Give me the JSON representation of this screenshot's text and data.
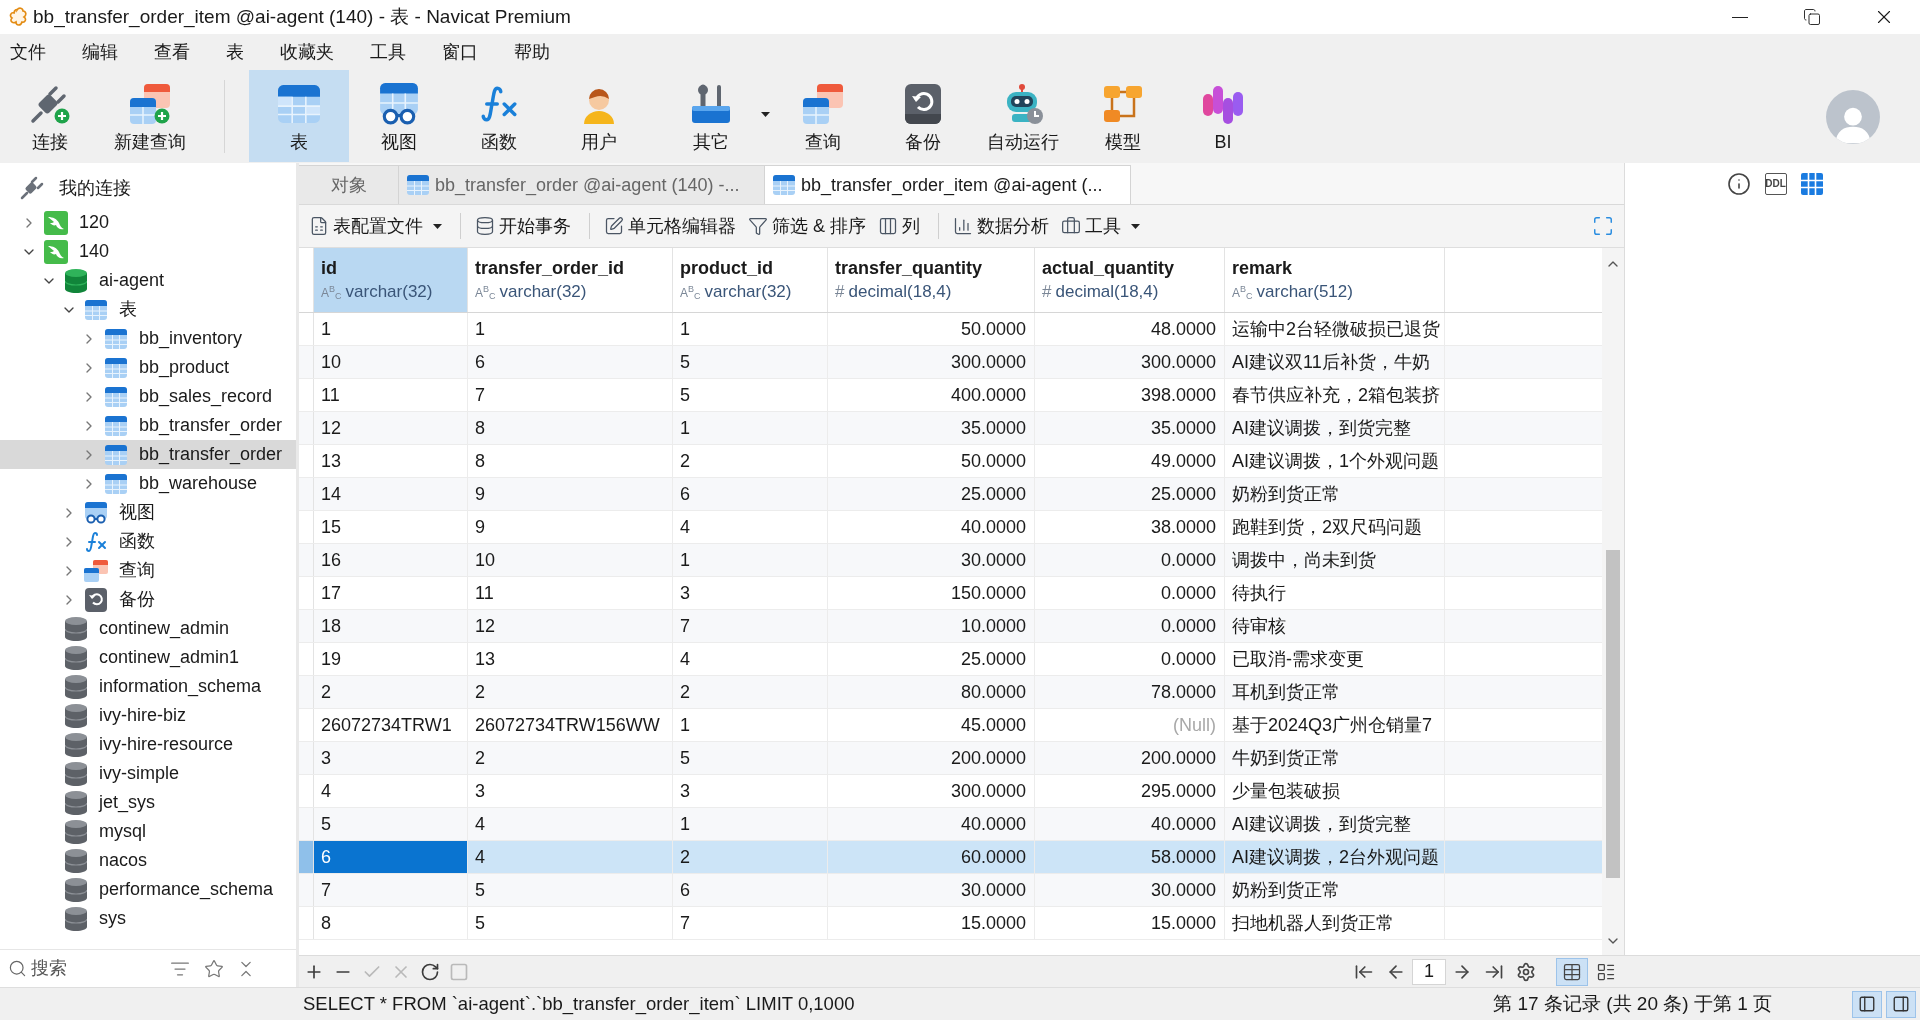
{
  "window": {
    "title": "bb_transfer_order_item @ai-agent (140) - 表 - Navicat Premium"
  },
  "menu": [
    "文件",
    "编辑",
    "查看",
    "表",
    "收藏夹",
    "工具",
    "窗口",
    "帮助"
  ],
  "toolbar": [
    {
      "items": [
        {
          "label": "连接",
          "kind": "connect",
          "selected": false
        },
        {
          "label": "新建查询",
          "kind": "new_query",
          "selected": false
        }
      ]
    },
    {
      "items": [
        {
          "label": "表",
          "kind": "table",
          "selected": true
        },
        {
          "label": "视图",
          "kind": "view",
          "selected": false
        },
        {
          "label": "函数",
          "kind": "function",
          "selected": false
        },
        {
          "label": "用户",
          "kind": "user",
          "selected": false
        },
        {
          "label": "其它",
          "kind": "other",
          "selected": false,
          "dropdown": true
        },
        {
          "label": "查询",
          "kind": "query",
          "selected": false
        },
        {
          "label": "备份",
          "kind": "backup",
          "selected": false
        },
        {
          "label": "自动运行",
          "kind": "automation",
          "selected": false
        },
        {
          "label": "模型",
          "kind": "model",
          "selected": false
        },
        {
          "label": "BI",
          "kind": "bi",
          "selected": false
        }
      ]
    }
  ],
  "sidebar": {
    "title": "我的连接",
    "tree": [
      {
        "label": "120",
        "kind": "connection",
        "expanded": false,
        "selected": false
      },
      {
        "label": "140",
        "kind": "connection",
        "expanded": true,
        "selected": false,
        "children": [
          {
            "label": "ai-agent",
            "kind": "database",
            "expanded": true,
            "selected": false,
            "children": [
              {
                "label": "表",
                "kind": "tables",
                "expanded": true,
                "selected": false,
                "children": [
                  {
                    "label": "bb_inventory",
                    "kind": "table",
                    "expanded": false,
                    "selected": false
                  },
                  {
                    "label": "bb_product",
                    "kind": "table",
                    "expanded": false,
                    "selected": false
                  },
                  {
                    "label": "bb_sales_record",
                    "kind": "table",
                    "expanded": false,
                    "selected": false
                  },
                  {
                    "label": "bb_transfer_order",
                    "kind": "table",
                    "expanded": false,
                    "selected": false
                  },
                  {
                    "label": "bb_transfer_order",
                    "kind": "table",
                    "expanded": false,
                    "selected": true
                  },
                  {
                    "label": "bb_warehouse",
                    "kind": "table",
                    "expanded": false,
                    "selected": false
                  }
                ]
              },
              {
                "label": "视图",
                "kind": "views",
                "expanded": false,
                "selected": false
              },
              {
                "label": "函数",
                "kind": "functions",
                "expanded": false,
                "selected": false
              },
              {
                "label": "查询",
                "kind": "queries",
                "expanded": false,
                "selected": false
              },
              {
                "label": "备份",
                "kind": "backups",
                "expanded": false,
                "selected": false
              }
            ]
          },
          {
            "label": "continew_admin",
            "kind": "closed_database",
            "selected": false
          },
          {
            "label": "continew_admin1",
            "kind": "closed_database",
            "selected": false
          },
          {
            "label": "information_schema",
            "kind": "closed_database",
            "selected": false
          },
          {
            "label": "ivy-hire-biz",
            "kind": "closed_database",
            "selected": false
          },
          {
            "label": "ivy-hire-resource",
            "kind": "closed_database",
            "selected": false
          },
          {
            "label": "ivy-simple",
            "kind": "closed_database",
            "selected": false
          },
          {
            "label": "jet_sys",
            "kind": "closed_database",
            "selected": false
          },
          {
            "label": "mysql",
            "kind": "closed_database",
            "selected": false
          },
          {
            "label": "nacos",
            "kind": "closed_database",
            "selected": false
          },
          {
            "label": "performance_schema",
            "kind": "closed_database",
            "selected": false
          },
          {
            "label": "sys",
            "kind": "closed_database",
            "selected": false
          }
        ]
      }
    ],
    "search": {
      "placeholder": "搜索"
    }
  },
  "tabs": [
    {
      "label": "对象",
      "kind": "objects",
      "selected": false
    },
    {
      "label": "bb_transfer_order @ai-agent (140) -...",
      "kind": "table",
      "selected": false
    },
    {
      "label": "bb_transfer_order_item @ai-agent (...",
      "kind": "table",
      "selected": true
    }
  ],
  "table_toolbar": [
    {
      "items": [
        {
          "label": "表配置文件",
          "kind": "profile",
          "dropdown": true
        }
      ]
    },
    {
      "items": [
        {
          "label": "开始事务",
          "kind": "transaction"
        }
      ]
    },
    {
      "items": [
        {
          "label": "单元格编辑器",
          "kind": "cell_editor"
        },
        {
          "label": "筛选 & 排序",
          "kind": "filter_sort"
        },
        {
          "label": "列",
          "kind": "columns"
        }
      ]
    },
    {
      "items": [
        {
          "label": "数据分析",
          "kind": "analysis"
        },
        {
          "label": "工具",
          "kind": "tools",
          "dropdown": true
        }
      ]
    }
  ],
  "table": {
    "columns": [
      {
        "name": "id",
        "type_icon": "A$^{B}$$_{C}$",
        "type": "varchar(32)",
        "kind": "text",
        "selected": true
      },
      {
        "name": "transfer_order_id",
        "type_icon": "A$^{B}$$_{C}$",
        "type": "varchar(32)",
        "kind": "text",
        "selected": false
      },
      {
        "name": "product_id",
        "type_icon": "A$^{B}$$_{C}$",
        "type": "varchar(32)",
        "kind": "text",
        "selected": false
      },
      {
        "name": "transfer_quantity",
        "type_icon": "#",
        "type": "decimal(18,4)",
        "kind": "number",
        "selected": false
      },
      {
        "name": "actual_quantity",
        "type_icon": "#",
        "type": "decimal(18,4)",
        "kind": "number",
        "selected": false
      },
      {
        "name": "remark",
        "type_icon": "A$^{B}$$_{C}$",
        "type": "varchar(512)",
        "kind": "text",
        "selected": false
      }
    ],
    "rows": [
      {
        "selected": false,
        "cells": [
          "1",
          "1",
          "1",
          "50.0000",
          "48.0000",
          "运输中2台轻微破损已退货"
        ]
      },
      {
        "selected": false,
        "cells": [
          "10",
          "6",
          "5",
          "300.0000",
          "300.0000",
          "AI建议双11后补货，牛奶"
        ]
      },
      {
        "selected": false,
        "cells": [
          "11",
          "7",
          "5",
          "400.0000",
          "398.0000",
          "春节供应补充，2箱包装挤"
        ]
      },
      {
        "selected": false,
        "cells": [
          "12",
          "8",
          "1",
          "35.0000",
          "35.0000",
          "AI建议调拨，到货完整"
        ]
      },
      {
        "selected": false,
        "cells": [
          "13",
          "8",
          "2",
          "50.0000",
          "49.0000",
          "AI建议调拨，1个外观问题"
        ]
      },
      {
        "selected": false,
        "cells": [
          "14",
          "9",
          "6",
          "25.0000",
          "25.0000",
          "奶粉到货正常"
        ]
      },
      {
        "selected": false,
        "cells": [
          "15",
          "9",
          "4",
          "40.0000",
          "38.0000",
          "跑鞋到货，2双尺码问题"
        ]
      },
      {
        "selected": false,
        "cells": [
          "16",
          "10",
          "1",
          "30.0000",
          "0.0000",
          "调拨中，尚未到货"
        ]
      },
      {
        "selected": false,
        "cells": [
          "17",
          "11",
          "3",
          "150.0000",
          "0.0000",
          "待执行"
        ]
      },
      {
        "selected": false,
        "cells": [
          "18",
          "12",
          "7",
          "10.0000",
          "0.0000",
          "待审核"
        ]
      },
      {
        "selected": false,
        "cells": [
          "19",
          "13",
          "4",
          "25.0000",
          "0.0000",
          "已取消-需求变更"
        ]
      },
      {
        "selected": false,
        "cells": [
          "2",
          "2",
          "2",
          "80.0000",
          "78.0000",
          "耳机到货正常"
        ]
      },
      {
        "selected": false,
        "cells": [
          "26072734TRW1",
          "26072734TRW156WW",
          "1",
          "45.0000",
          {
            "kind": "null",
            "text": "(Null)"
          },
          "基于2024Q3广州仓销量7"
        ]
      },
      {
        "selected": false,
        "cells": [
          "3",
          "2",
          "5",
          "200.0000",
          "200.0000",
          "牛奶到货正常"
        ]
      },
      {
        "selected": false,
        "cells": [
          "4",
          "3",
          "3",
          "300.0000",
          "295.0000",
          "少量包装破损"
        ]
      },
      {
        "selected": false,
        "cells": [
          "5",
          "4",
          "1",
          "40.0000",
          "40.0000",
          "AI建议调拨，到货完整"
        ]
      },
      {
        "selected": true,
        "cells": [
          "6",
          "4",
          "2",
          "60.0000",
          "58.0000",
          "AI建议调拨，2台外观问题"
        ]
      },
      {
        "selected": false,
        "cells": [
          "7",
          "5",
          "6",
          "30.0000",
          "30.0000",
          "奶粉到货正常"
        ]
      },
      {
        "selected": false,
        "cells": [
          "8",
          "5",
          "7",
          "15.0000",
          "15.0000",
          "扫地机器人到货正常"
        ]
      }
    ]
  },
  "record_buttons": [
    {
      "kind": "add",
      "disabled": false
    },
    {
      "kind": "delete",
      "disabled": false
    },
    {
      "kind": "apply",
      "disabled": true
    },
    {
      "kind": "discard",
      "disabled": true
    },
    {
      "kind": "refresh",
      "disabled": false
    },
    {
      "kind": "stop",
      "disabled": true
    }
  ],
  "pager": {
    "page": "1"
  },
  "view_modes": [
    {
      "kind": "grid",
      "selected": true
    },
    {
      "kind": "form",
      "selected": false
    }
  ],
  "right_panel": {
    "tabs": [
      {
        "kind": "info",
        "selected": false
      },
      {
        "kind": "ddl",
        "label": "DDL",
        "selected": false
      },
      {
        "kind": "grid",
        "selected": true
      }
    ]
  },
  "status_bar": {
    "sql": "SELECT * FROM `ai-agent`.`bb_transfer_order_item` LIMIT 0,1000",
    "record_info": "第 17 条记录 (共 20 条) 于第 1 页",
    "panels": [
      {
        "kind": "left",
        "selected": true
      },
      {
        "kind": "right",
        "selected": true
      }
    ]
  }
}
